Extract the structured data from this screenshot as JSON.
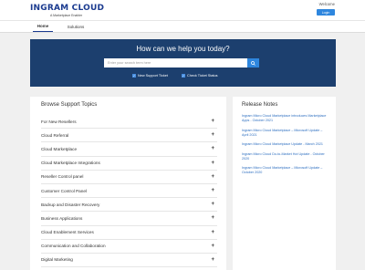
{
  "header": {
    "logo_text": "INGRAM",
    "logo_cloud": "CLOUD",
    "logo_tagline": "A Marketplace Enabler",
    "welcome": "Welcome",
    "login_label": "Login"
  },
  "nav": {
    "items": [
      {
        "label": "Home",
        "active": true
      },
      {
        "label": "Solutions",
        "active": false
      }
    ]
  },
  "hero": {
    "title": "How can we help you today?",
    "search_placeholder": "Enter your search term here",
    "checkboxes": [
      {
        "label": "New Support Ticket",
        "checked": true
      },
      {
        "label": "Check Ticket Status",
        "checked": true
      }
    ],
    "colors": {
      "background": "#1c3f6e",
      "accent": "#2e86de"
    }
  },
  "topics": {
    "title": "Browse Support Topics",
    "items": [
      "For New Resellers",
      "Cloud Referral",
      "Cloud Marketplace",
      "Cloud Marketplace Integrations",
      "Reseller Control panel",
      "Customer Control Panel",
      "Backup and Disaster Recovery",
      "Business Applications",
      "Cloud Enablement Services",
      "Communication and Collaboration",
      "Digital Marketing"
    ],
    "expand_icon": "plus-icon"
  },
  "release_notes": {
    "title": "Release Notes",
    "items": [
      "Ingram Micro Cloud Marketplace introduces Marketplace Apps - October 2021",
      "Ingram Micro Cloud Marketplace – Microsoft Update – April 2021",
      "Ingram Micro Cloud Marketplace Update - March 2021",
      "Ingram Micro Cloud Do-to-Market Hot Update - October 2020",
      "Ingram Micro Cloud Marketplace – Microsoft Update – October 2020"
    ]
  }
}
